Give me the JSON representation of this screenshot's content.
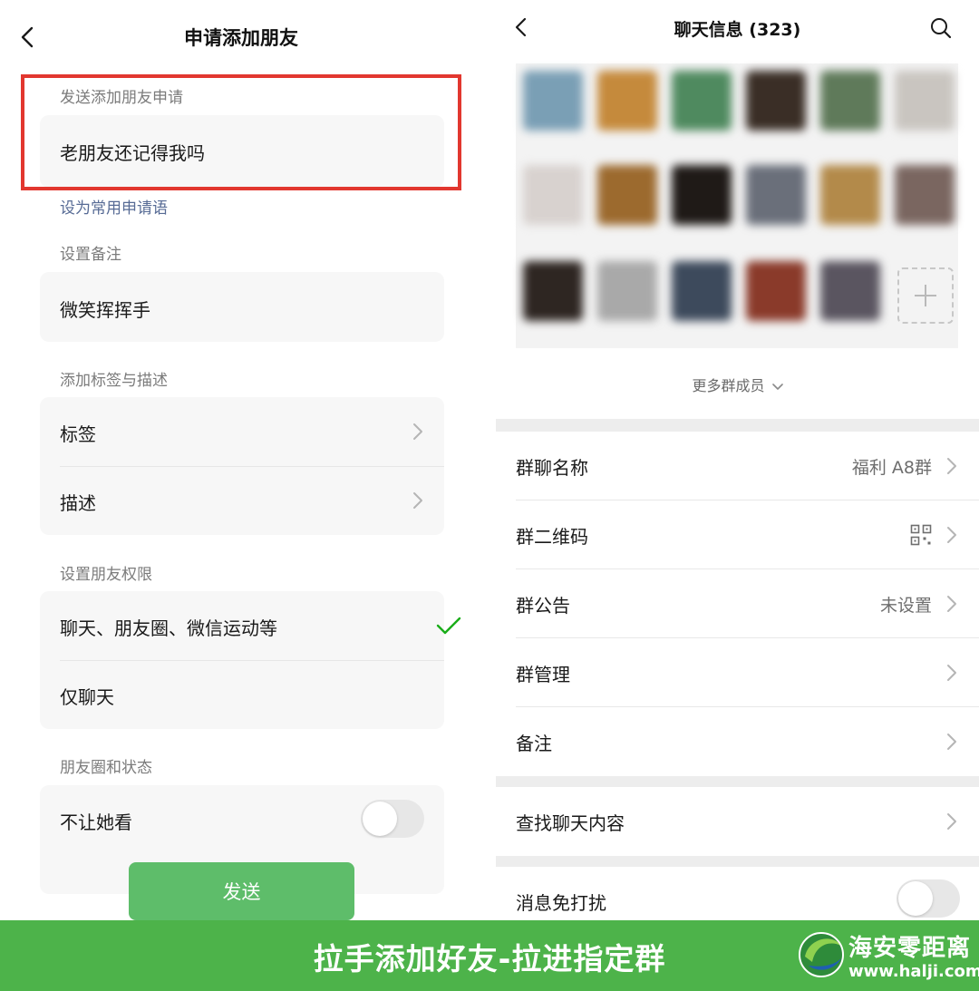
{
  "left": {
    "title": "申请添加朋友",
    "request_section_label": "发送添加朋友申请",
    "request_message": "老朋友还记得我吗",
    "set_common_link": "设为常用申请语",
    "remark_section_label": "设置备注",
    "remark_value": "微笑挥挥手",
    "tag_section_label": "添加标签与描述",
    "tag_row": "标签",
    "desc_row": "描述",
    "permission_section_label": "设置朋友权限",
    "permission_options": [
      {
        "label": "聊天、朋友圈、微信运动等",
        "selected": true
      },
      {
        "label": "仅聊天",
        "selected": false
      }
    ],
    "moments_section_label": "朋友圈和状态",
    "hide_from_her": {
      "label": "不让她看",
      "on": false
    },
    "send_button": "发送"
  },
  "right": {
    "title": "聊天信息 (323)",
    "more_members": "更多群成员",
    "rows": [
      {
        "label": "群聊名称",
        "value": "福利 A8群"
      },
      {
        "label": "群二维码",
        "value": ""
      },
      {
        "label": "群公告",
        "value": "未设置"
      },
      {
        "label": "群管理",
        "value": ""
      },
      {
        "label": "备注",
        "value": ""
      }
    ],
    "search_history": "查找聊天内容",
    "mute": {
      "label": "消息免打扰",
      "on": false
    }
  },
  "banner": {
    "text": "拉手添加好友-拉进指定群",
    "brand_name": "海安零距离",
    "brand_url": "www.halji.com"
  },
  "colors": {
    "highlight_border": "#e2372f",
    "link_blue": "#576b95",
    "check_green": "#1aad19",
    "send_button": "#5ebd6a",
    "banner_green": "#4db34a"
  }
}
